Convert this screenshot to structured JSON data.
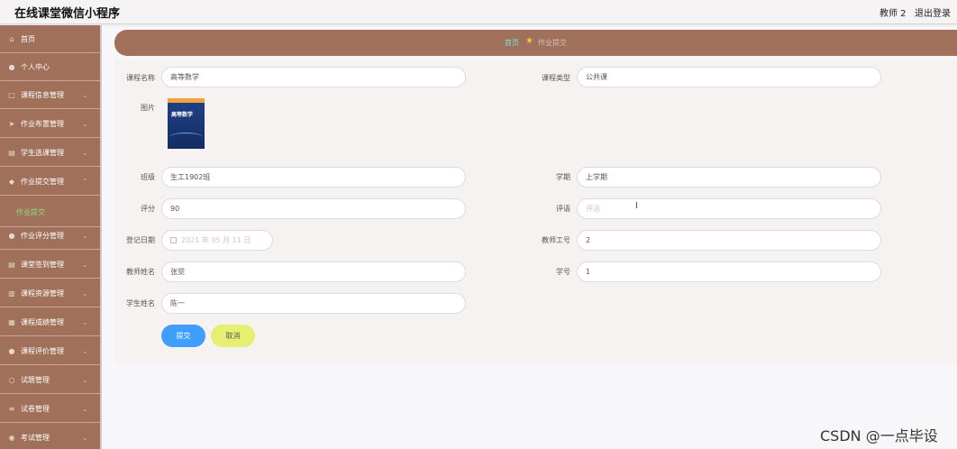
{
  "app": {
    "title": "在线课堂微信小程序",
    "user": "教师 2",
    "logout": "退出登录"
  },
  "sidebar": {
    "items": [
      {
        "label": "首页",
        "icon": "home-icon"
      },
      {
        "label": "个人中心",
        "icon": "user-icon"
      },
      {
        "label": "课程信息管理",
        "icon": "box-icon"
      },
      {
        "label": "作业布置管理",
        "icon": "send-icon"
      },
      {
        "label": "学生选课管理",
        "icon": "table-icon"
      },
      {
        "label": "作业提交管理",
        "icon": "shield-icon"
      },
      {
        "label": "作业评分管理",
        "icon": "user-icon"
      },
      {
        "label": "课堂签到管理",
        "icon": "table-icon"
      },
      {
        "label": "课程资源管理",
        "icon": "chart-icon"
      },
      {
        "label": "课程成绩管理",
        "icon": "grid-icon"
      },
      {
        "label": "课程评价管理",
        "icon": "user-icon"
      },
      {
        "label": "试题管理",
        "icon": "circle-icon"
      },
      {
        "label": "试卷管理",
        "icon": "list-icon"
      },
      {
        "label": "考试管理",
        "icon": "pin-icon"
      }
    ],
    "active_sub": "作业提交"
  },
  "breadcrumb": {
    "home": "首页",
    "current": "作业提交"
  },
  "form": {
    "course_name": {
      "label": "课程名称",
      "value": "高等数学"
    },
    "course_type": {
      "label": "课程类型",
      "value": "公共课"
    },
    "picture": {
      "label": "图片",
      "cover_title": "高等数学"
    },
    "class_name": {
      "label": "班级",
      "value": "生工1902班"
    },
    "semester": {
      "label": "学期",
      "value": "上学期"
    },
    "score": {
      "label": "评分",
      "value": "90"
    },
    "comment": {
      "label": "评语",
      "placeholder": "评语"
    },
    "reg_date": {
      "label": "登记日期",
      "value": "2021 年 05 月 11 日"
    },
    "teacher_id": {
      "label": "教师工号",
      "value": "2"
    },
    "teacher_name": {
      "label": "教师姓名",
      "value": "张觉"
    },
    "student_id": {
      "label": "学号",
      "value": "1"
    },
    "student_name": {
      "label": "学生姓名",
      "value": "陈一"
    },
    "submit_label": "提交",
    "cancel_label": "取消"
  },
  "watermark": "CSDN @一点毕设",
  "colors": {
    "sidebar": "#a0705a",
    "primary": "#409eff",
    "cancel": "#e6ef72",
    "active_sub": "#8fe07b"
  }
}
